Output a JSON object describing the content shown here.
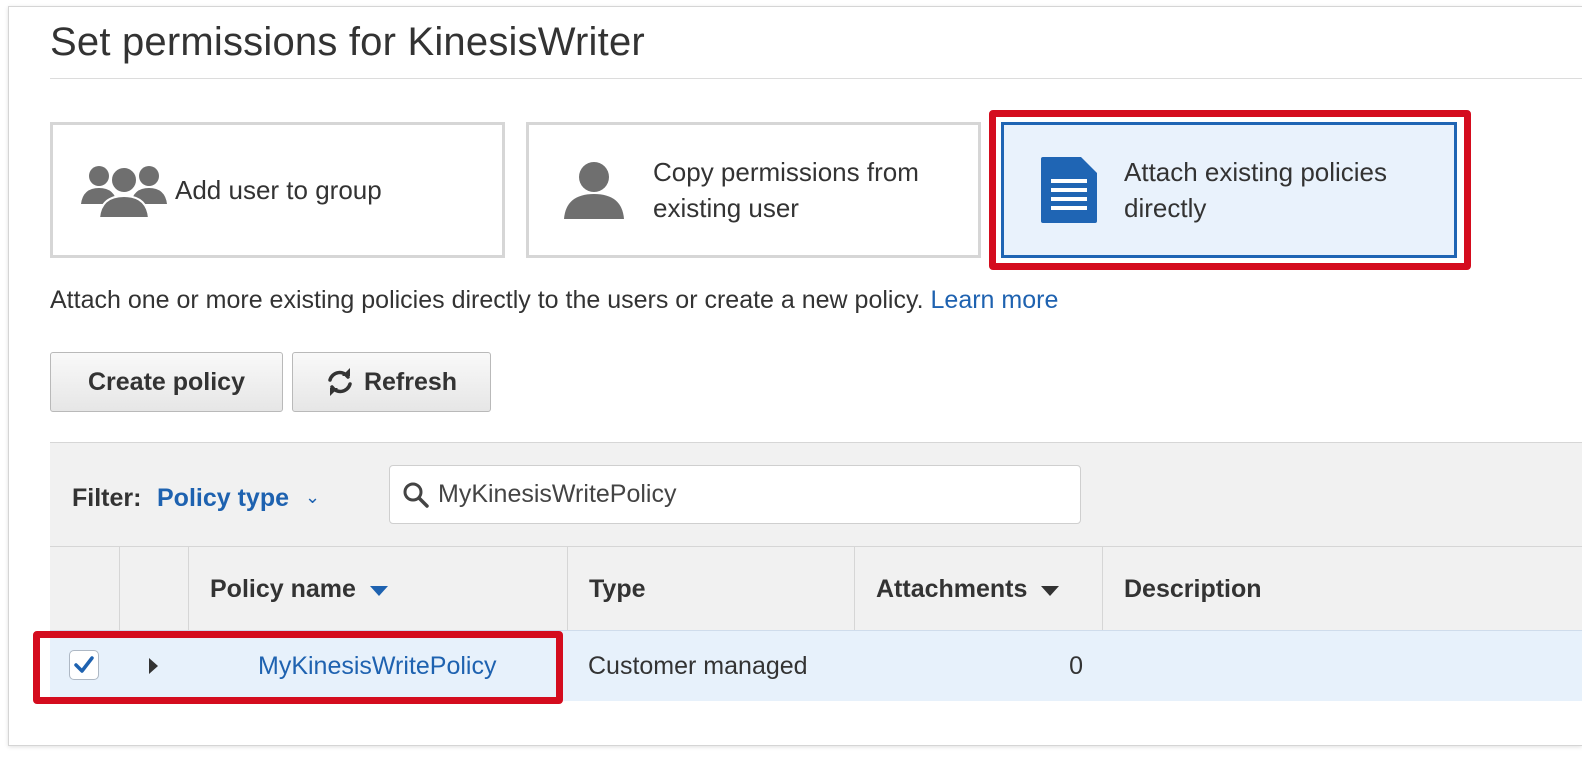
{
  "page": {
    "title": "Set permissions for KinesisWriter"
  },
  "options": [
    {
      "label": "Add user to group",
      "icon": "users-group-icon",
      "selected": false
    },
    {
      "label_line1": "Copy permissions from",
      "label_line2": "existing user",
      "icon": "user-icon",
      "selected": false
    },
    {
      "label_line1": "Attach existing policies",
      "label_line2": "directly",
      "icon": "document-icon",
      "selected": true
    }
  ],
  "description": {
    "text": "Attach one or more existing policies directly to the users or create a new policy.",
    "link": "Learn more"
  },
  "buttons": {
    "create_policy": "Create policy",
    "refresh": "Refresh"
  },
  "filter": {
    "label": "Filter:",
    "dropdown": "Policy type",
    "search_value": "MyKinesisWritePolicy"
  },
  "table": {
    "columns": [
      "Policy name",
      "Type",
      "Attachments",
      "Description"
    ],
    "rows": [
      {
        "checked": true,
        "policy_name": "MyKinesisWritePolicy",
        "type": "Customer managed",
        "attachments": "0",
        "description": ""
      }
    ]
  },
  "colors": {
    "accent": "#1e62b0",
    "highlight": "#d40c1e",
    "selected_bg": "#e9f2fc"
  }
}
